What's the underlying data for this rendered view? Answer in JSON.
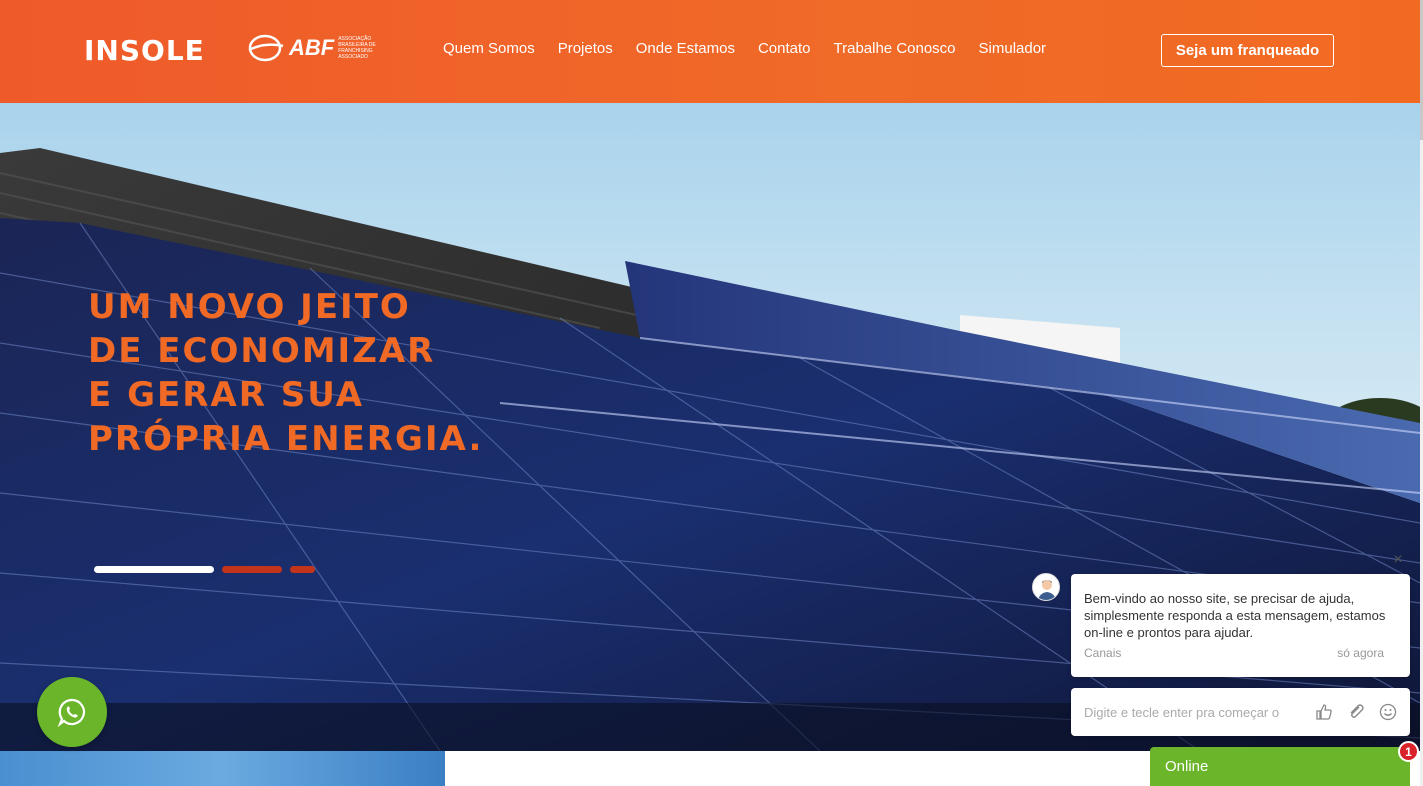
{
  "header": {
    "logo_text": "INSOLE",
    "abf_text": "ABF",
    "abf_subtext": "ASSOCIAÇÃO BRASILEIRA DE FRANCHISING",
    "abf_associado": "ASSOCIADO",
    "nav": [
      {
        "label": "Quem Somos"
      },
      {
        "label": "Projetos"
      },
      {
        "label": "Onde Estamos"
      },
      {
        "label": "Contato"
      },
      {
        "label": "Trabalhe Conosco"
      },
      {
        "label": "Simulador"
      }
    ],
    "cta_label": "Seja um franqueado"
  },
  "hero": {
    "headline_lines": [
      "UM NOVO JEITO",
      "DE ECONOMIZAR",
      "E GERAR SUA",
      "PRÓPRIA ENERGIA."
    ],
    "slider_active_index": 0,
    "slider_count": 3
  },
  "chat": {
    "message": "Bem-vindo ao nosso site, se precisar de ajuda, simplesmente responda a esta mensagem, estamos on-line e prontos para ajudar.",
    "sender": "Canais",
    "time": "só agora",
    "input_placeholder": "Digite e tecle enter pra começar o",
    "status": "Online",
    "unread_count": "1",
    "close_symbol": "×"
  },
  "colors": {
    "brand_orange": "#f06a25",
    "whatsapp_green": "#6bb52a",
    "badge_red": "#d8232a"
  },
  "icons": [
    "whatsapp-icon",
    "close-icon",
    "thumbs-up-icon",
    "paperclip-icon",
    "smiley-icon",
    "avatar-icon"
  ]
}
